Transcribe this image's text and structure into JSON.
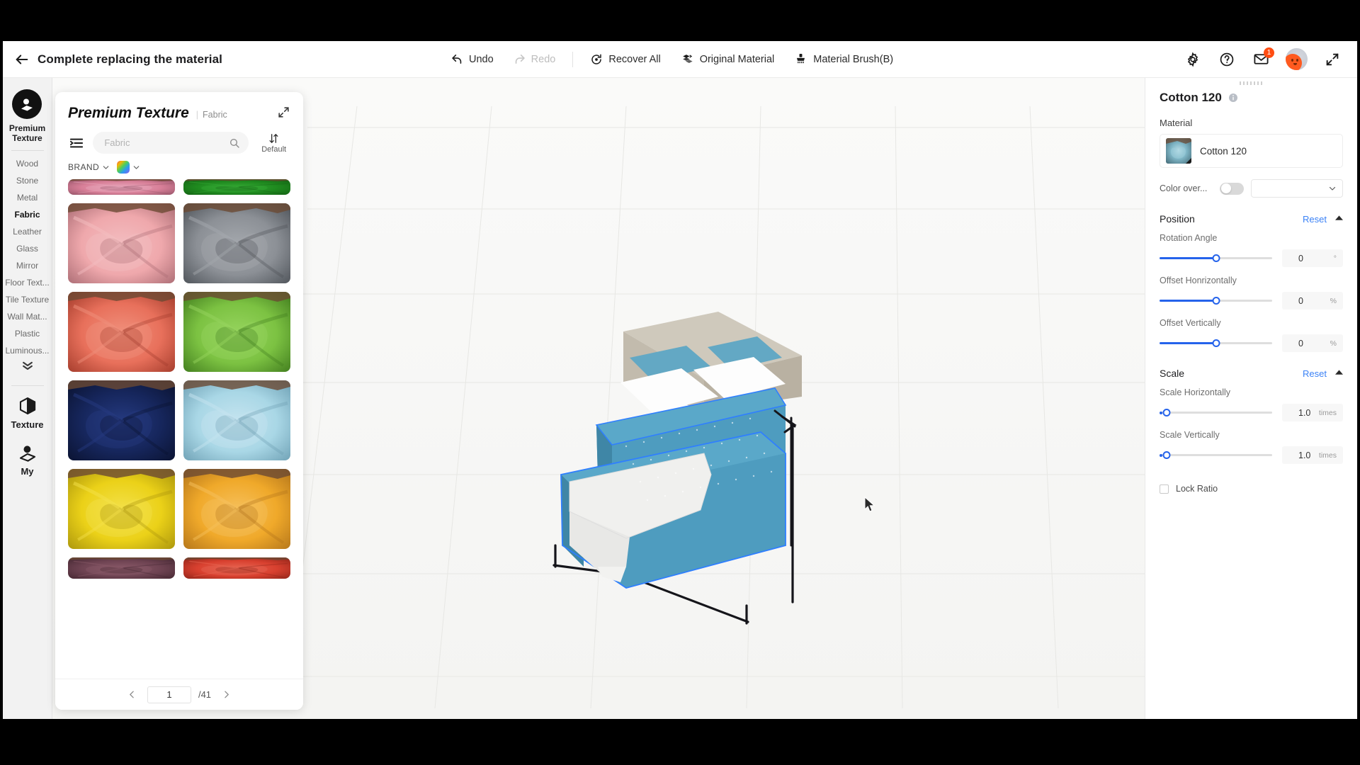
{
  "header": {
    "title": "Complete replacing the material",
    "back_icon": "arrow-left-icon",
    "tools": [
      {
        "label": "Undo",
        "icon": "undo-icon",
        "disabled": false
      },
      {
        "label": "Redo",
        "icon": "redo-icon",
        "disabled": true
      },
      {
        "label": "Recover All",
        "icon": "recover-icon",
        "disabled": false
      },
      {
        "label": "Original Material",
        "icon": "original-material-icon",
        "disabled": false
      },
      {
        "label": "Material Brush(B)",
        "icon": "brush-icon",
        "disabled": false
      }
    ],
    "right_icons": [
      {
        "name": "gear-icon"
      },
      {
        "name": "help-icon"
      },
      {
        "name": "mail-icon",
        "badge": "1"
      },
      {
        "name": "avatar"
      },
      {
        "name": "fullscreen-icon"
      }
    ],
    "notification_count": "1"
  },
  "rail": {
    "brand_label": "Premium\nTexture",
    "brand_line1": "Premium",
    "brand_line2": "Texture",
    "brand_icon": "premium-texture-icon",
    "categories": [
      {
        "label": "Wood",
        "active": false
      },
      {
        "label": "Stone",
        "active": false
      },
      {
        "label": "Metal",
        "active": false
      },
      {
        "label": "Fabric",
        "active": true
      },
      {
        "label": "Leather",
        "active": false
      },
      {
        "label": "Glass",
        "active": false
      },
      {
        "label": "Mirror",
        "active": false
      },
      {
        "label": "Floor Text...",
        "active": false
      },
      {
        "label": "Tile Texture",
        "active": false
      },
      {
        "label": "Wall Mat...",
        "active": false
      },
      {
        "label": "Plastic",
        "active": false
      },
      {
        "label": "Luminous...",
        "active": false
      }
    ],
    "more_icon": "chevron-double-down-icon",
    "bottom_items": [
      {
        "label": "Texture",
        "icon": "cube-icon"
      },
      {
        "label": "My",
        "icon": "user-icon"
      }
    ]
  },
  "browser": {
    "title": "Premium Texture",
    "subtitle": "Fabric",
    "expand_icon": "expand-diagonal-icon",
    "filter_icon": "filter-list-icon",
    "search": {
      "value": "",
      "placeholder": "Fabric",
      "icon": "search-icon"
    },
    "sort": {
      "icon": "sort-updown-icon",
      "label": "Default"
    },
    "brand_filter": {
      "label": "BRAND",
      "caret": "chevron-down-icon"
    },
    "color_filter": {
      "swatch": "rainbow-swatch",
      "caret": "chevron-down-icon"
    },
    "swatches": [
      {
        "name": "Pink Partial",
        "top": "#d87f98",
        "mid": "#e8a7bb",
        "dark": "#8e4f63",
        "partial": true
      },
      {
        "name": "Green Partial",
        "top": "#1f8a1f",
        "mid": "#35a935",
        "dark": "#135f13",
        "partial": true
      },
      {
        "name": "Blush Pink",
        "top": "#efa8ac",
        "mid": "#f3bdc0",
        "dark": "#a86a72"
      },
      {
        "name": "Charcoal Gray",
        "top": "#8c9096",
        "mid": "#a4a8ad",
        "dark": "#4c5157"
      },
      {
        "name": "Coral Red",
        "top": "#e8705b",
        "mid": "#f0907c",
        "dark": "#a13a2a"
      },
      {
        "name": "Apple Green",
        "top": "#7cc242",
        "mid": "#96d45e",
        "dark": "#3f7a1d"
      },
      {
        "name": "Navy Blue",
        "top": "#16265c",
        "mid": "#253a80",
        "dark": "#0a122f"
      },
      {
        "name": "Ice Blue",
        "top": "#a9d7e6",
        "mid": "#c5e4ef",
        "dark": "#6d9fb3"
      },
      {
        "name": "Lemon Yellow",
        "top": "#ebd118",
        "mid": "#f3e14a",
        "dark": "#a8930c"
      },
      {
        "name": "Amber Orange",
        "top": "#f0a92a",
        "mid": "#f6c05c",
        "dark": "#b2741a"
      },
      {
        "name": "Plum",
        "top": "#6e4352",
        "mid": "#8a5968",
        "dark": "#432630",
        "partial": true
      },
      {
        "name": "Crimson",
        "top": "#d8402f",
        "mid": "#e76552",
        "dark": "#8c2318",
        "partial": true
      }
    ],
    "pager": {
      "prev_icon": "chevron-left-icon",
      "next_icon": "chevron-right-icon",
      "current": "1",
      "total": "/41"
    }
  },
  "props": {
    "title": "Cotton 120",
    "info_icon": "info-icon",
    "material_label": "Material",
    "material": {
      "name": "Cotton 120",
      "thumb": "cotton-120-thumb"
    },
    "color_override": {
      "label": "Color over...",
      "enabled": false,
      "select_value": "",
      "caret": "chevron-down-icon"
    },
    "position": {
      "title": "Position",
      "reset_label": "Reset",
      "caret": "caret-up-icon",
      "fields": [
        {
          "label": "Rotation Angle",
          "value": "0",
          "unit": "°",
          "fill_pct": 50
        },
        {
          "label": "Offset Honrizontally",
          "value": "0",
          "unit": "%",
          "fill_pct": 50
        },
        {
          "label": "Offset Vertically",
          "value": "0",
          "unit": "%",
          "fill_pct": 50
        }
      ]
    },
    "scale": {
      "title": "Scale",
      "reset_label": "Reset",
      "caret": "caret-up-icon",
      "fields": [
        {
          "label": "Scale Horizontally",
          "value": "1.0",
          "unit": "times",
          "fill_pct": 6
        },
        {
          "label": "Scale Vertically",
          "value": "1.0",
          "unit": "times",
          "fill_pct": 6
        }
      ]
    },
    "lock_ratio": {
      "label": "Lock Ratio",
      "checked": false
    }
  },
  "viewport": {
    "feedback_icon": "feedback-icon",
    "feedback_close": "×",
    "cursor": "pointer-arrow"
  },
  "colors": {
    "accent_blue": "#2563eb",
    "link_blue": "#3b82f6",
    "badge_orange": "#ff4d12",
    "bed_fabric": "#4e9cbf"
  }
}
